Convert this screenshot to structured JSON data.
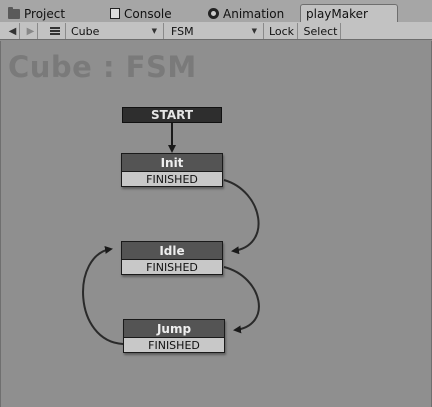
{
  "tabs": [
    {
      "label": "Project",
      "icon": "folder-icon"
    },
    {
      "label": "Console",
      "icon": "console-icon"
    },
    {
      "label": "Animation",
      "icon": "animation-icon"
    },
    {
      "label": "playMaker",
      "active": true
    }
  ],
  "toolbar": {
    "prev_icon": "◀",
    "next_icon": "▶",
    "gameobject": "Cube",
    "fsm": "FSM",
    "lock_label": "Lock",
    "select_label": "Select"
  },
  "canvas": {
    "title": "Cube : FSM",
    "start_label": "START",
    "states": [
      {
        "name": "Init",
        "event": "FINISHED"
      },
      {
        "name": "Idle",
        "event": "FINISHED"
      },
      {
        "name": "Jump",
        "event": "FINISHED"
      }
    ]
  },
  "colors": {
    "canvas_bg": "#8f8f8f",
    "state_header": "#545454",
    "event_bg": "#c8c8c8",
    "start_bg": "#2e2e2e",
    "link": "#2a2a2a"
  }
}
